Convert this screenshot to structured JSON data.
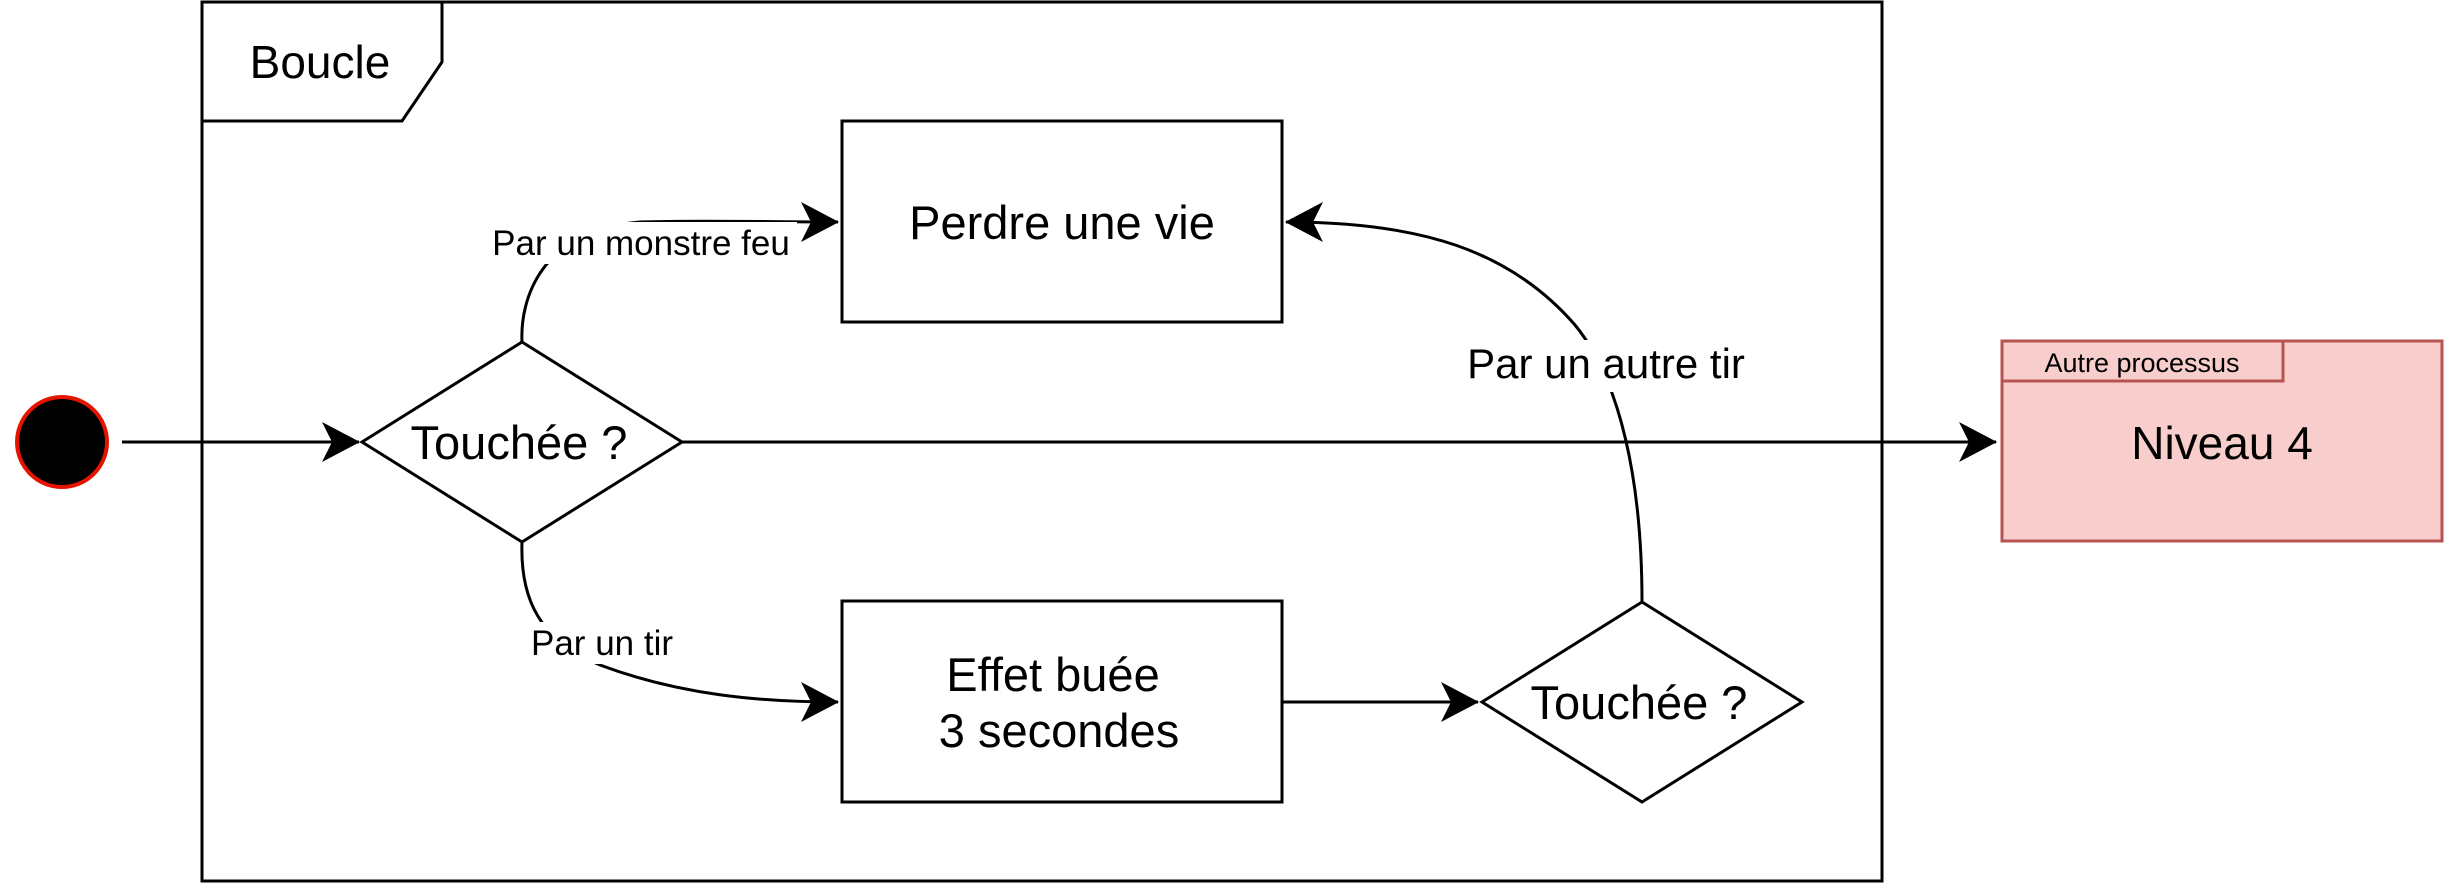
{
  "frame": {
    "label": "Boucle"
  },
  "nodes": {
    "decision1": {
      "label": "Touchée ?"
    },
    "lose_life": {
      "label": "Perdre une vie"
    },
    "fog_effect": {
      "line1": "Effet buée",
      "line2": "3 secondes"
    },
    "decision2": {
      "label": "Touchée ?"
    },
    "other_process": {
      "tab_label": "Autre processus",
      "label": "Niveau 4"
    }
  },
  "edges": {
    "fire_monster": "Par un monstre feu",
    "shot": "Par un tir",
    "other_shot": "Par un autre tir"
  },
  "colors": {
    "line": "#000000",
    "start_fill": "#000000",
    "start_stroke": "#e51400",
    "package_fill": "#f8cecc",
    "package_stroke": "#b85450"
  }
}
